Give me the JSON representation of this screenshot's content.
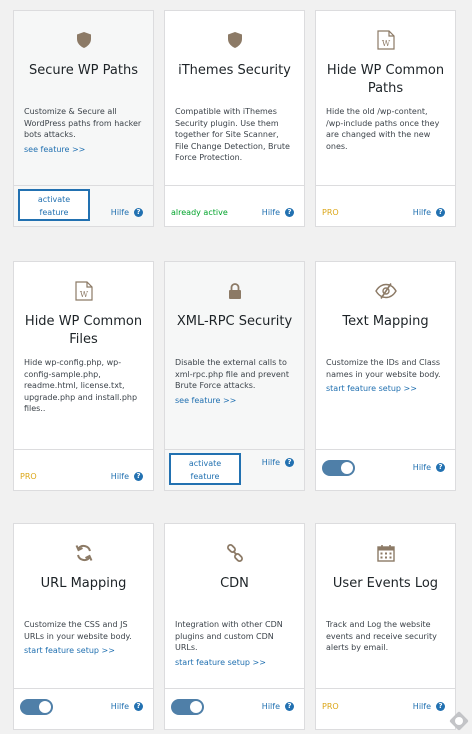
{
  "cards": [
    {
      "title": "Secure WP Paths",
      "desc": "Customize & Secure all WordPress paths from hacker bots attacks.",
      "link": "see feature >>",
      "status": "",
      "action": "activate feature",
      "help": "Hilfe",
      "help_mark": "?",
      "icon": "shield-icon"
    },
    {
      "title": "iThemes Security",
      "desc": "Compatible with iThemes Security plugin. Use them together for Site Scanner, File Change Detection, Brute Force Protection.",
      "link": "",
      "status": "already active",
      "action": "",
      "help": "Hilfe",
      "help_mark": "?",
      "icon": "shield-icon"
    },
    {
      "title": "Hide WP Common Paths",
      "desc": "Hide the old /wp-content, /wp-include paths once they are changed with the new ones.",
      "link": "",
      "status": "PRO",
      "action": "",
      "help": "Hilfe",
      "help_mark": "?",
      "icon": "wordpress-file-icon"
    },
    {
      "title": "Hide WP Common Files",
      "desc": "Hide wp-config.php, wp-config-sample.php, readme.html, license.txt, upgrade.php and install.php files..",
      "link": "",
      "status": "PRO",
      "action": "",
      "help": "Hilfe",
      "help_mark": "?",
      "icon": "wordpress-file-icon"
    },
    {
      "title": "XML-RPC Security",
      "desc": "Disable the external calls to xml-rpc.php file and prevent Brute Force attacks.",
      "link": "see feature >>",
      "status": "",
      "action": "activate feature",
      "help": "Hilfe",
      "help_mark": "?",
      "icon": "lock-icon"
    },
    {
      "title": "Text Mapping",
      "desc": "Customize the IDs and Class names in your website body.",
      "link": "start feature setup >>",
      "status": "",
      "action": "",
      "toggle_on": true,
      "help": "Hilfe",
      "help_mark": "?",
      "icon": "eye-slash-icon"
    },
    {
      "title": "URL Mapping",
      "desc": "Customize the CSS and JS URLs in your website body.",
      "link": "start feature setup >>",
      "status": "",
      "action": "",
      "toggle_on": true,
      "help": "Hilfe",
      "help_mark": "?",
      "icon": "refresh-icon"
    },
    {
      "title": "CDN",
      "desc": "Integration with other CDN plugins and custom CDN URLs.",
      "link": "start feature setup >>",
      "status": "",
      "action": "",
      "toggle_on": true,
      "help": "Hilfe",
      "help_mark": "?",
      "icon": "link-icon"
    },
    {
      "title": "User Events Log",
      "desc": "Track and Log the website events and receive security alerts by email.",
      "link": "",
      "status": "PRO",
      "action": "",
      "help": "Hilfe",
      "help_mark": "?",
      "icon": "calendar-icon"
    }
  ],
  "colors": {
    "accent": "#2271b1",
    "pro": "#dba617",
    "active": "#00a32a",
    "icon": "#8c7a66"
  }
}
